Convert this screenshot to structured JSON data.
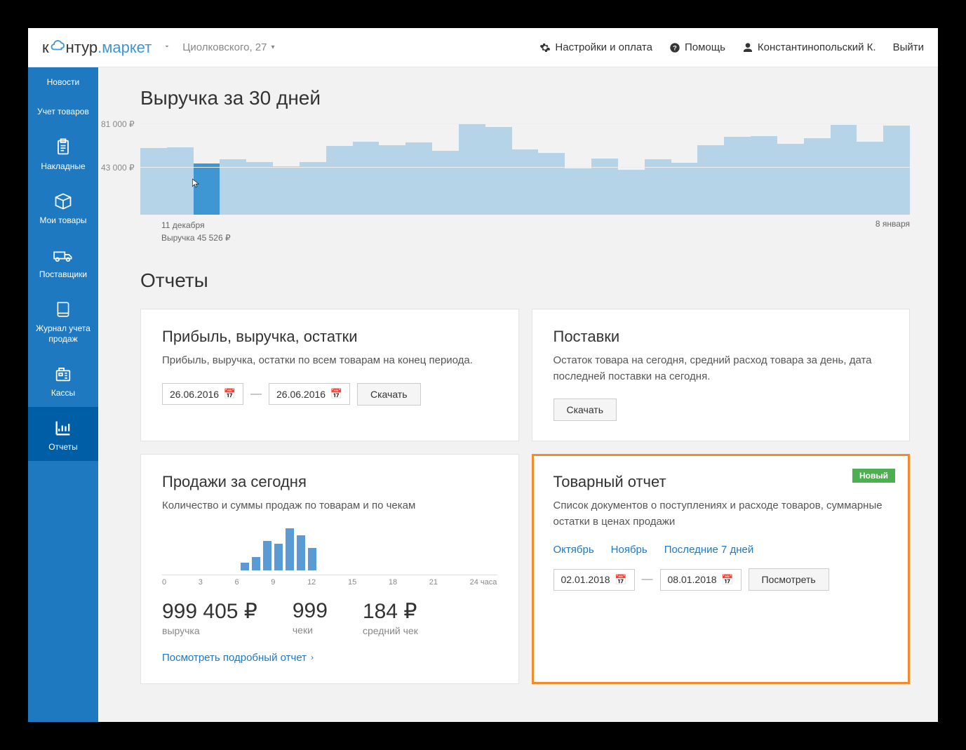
{
  "header": {
    "logo": {
      "prefix": "к",
      "mid": "нтур",
      "suffix": "маркет"
    },
    "address": "Циолковского, 27",
    "settings": "Настройки и оплата",
    "help": "Помощь",
    "user": "Константинопольский К.",
    "logout": "Выйти"
  },
  "sidebar": {
    "news": "Новости",
    "inventory": "Учет товаров",
    "invoices": "Накладные",
    "goods": "Мои товары",
    "suppliers": "Поставщики",
    "salesLog": "Журнал учета продаж",
    "registers": "Кассы",
    "reports": "Отчеты"
  },
  "revenue": {
    "title": "Выручка за 30 дней",
    "yticks": {
      "top": "81 000 ₽",
      "mid": "43 000 ₽"
    },
    "tooltip": {
      "date": "11 декабря",
      "value": "Выручка 45 526 ₽"
    },
    "endDate": "8 января"
  },
  "chart_data": {
    "type": "bar",
    "title": "Выручка за 30 дней",
    "ylabel": "₽",
    "ylim": [
      0,
      81000
    ],
    "start_date": "11 декабря",
    "end_date": "8 января",
    "values": [
      59000,
      60000,
      45526,
      49000,
      47000,
      43000,
      47000,
      61000,
      65000,
      62000,
      64000,
      57000,
      81000,
      78000,
      58000,
      55000,
      41000,
      50000,
      40000,
      49000,
      46000,
      62000,
      69000,
      70000,
      63000,
      68000,
      80000,
      65000,
      79000
    ],
    "selected": {
      "index": 2,
      "date": "11 декабря",
      "value": 45526
    }
  },
  "reportsTitle": "Отчеты",
  "cards": {
    "profit": {
      "title": "Прибыль, выручка, остатки",
      "desc": "Прибыль, выручка, остатки по всем товарам на конец периода.",
      "from": "26.06.2016",
      "to": "26.06.2016",
      "download": "Скачать"
    },
    "supplies": {
      "title": "Поставки",
      "desc": "Остаток товара на сегодня, средний расход товара за день, дата последней поставки на сегодня.",
      "download": "Скачать"
    },
    "today": {
      "title": "Продажи за сегодня",
      "desc": "Количество и суммы продаж по товарам и по чекам",
      "stats": {
        "revenue": {
          "value": "999 405 ₽",
          "label": "выручка"
        },
        "checks": {
          "value": "999",
          "label": "чеки"
        },
        "avg": {
          "value": "184 ₽",
          "label": "средний чек"
        }
      },
      "hourly_chart": {
        "type": "bar",
        "xlabel": "24 часа",
        "ticks": [
          0,
          3,
          6,
          9,
          12,
          15,
          18,
          21
        ],
        "values": [
          0,
          0,
          0,
          0,
          0,
          0,
          0,
          10,
          18,
          40,
          36,
          58,
          48,
          30,
          0,
          0,
          0,
          0,
          0,
          0,
          0,
          0,
          0,
          0
        ]
      },
      "axis_end": "24 часа",
      "link": "Посмотреть подробный отчет"
    },
    "goodsReport": {
      "title": "Товарный отчет",
      "badge": "Новый",
      "desc": "Список документов о поступлениях и расходе товаров, суммарные остатки в ценах продажи",
      "quick": {
        "oct": "Октябрь",
        "nov": "Ноябрь",
        "last7": "Последние 7 дней"
      },
      "from": "02.01.2018",
      "to": "08.01.2018",
      "view": "Посмотреть"
    }
  }
}
